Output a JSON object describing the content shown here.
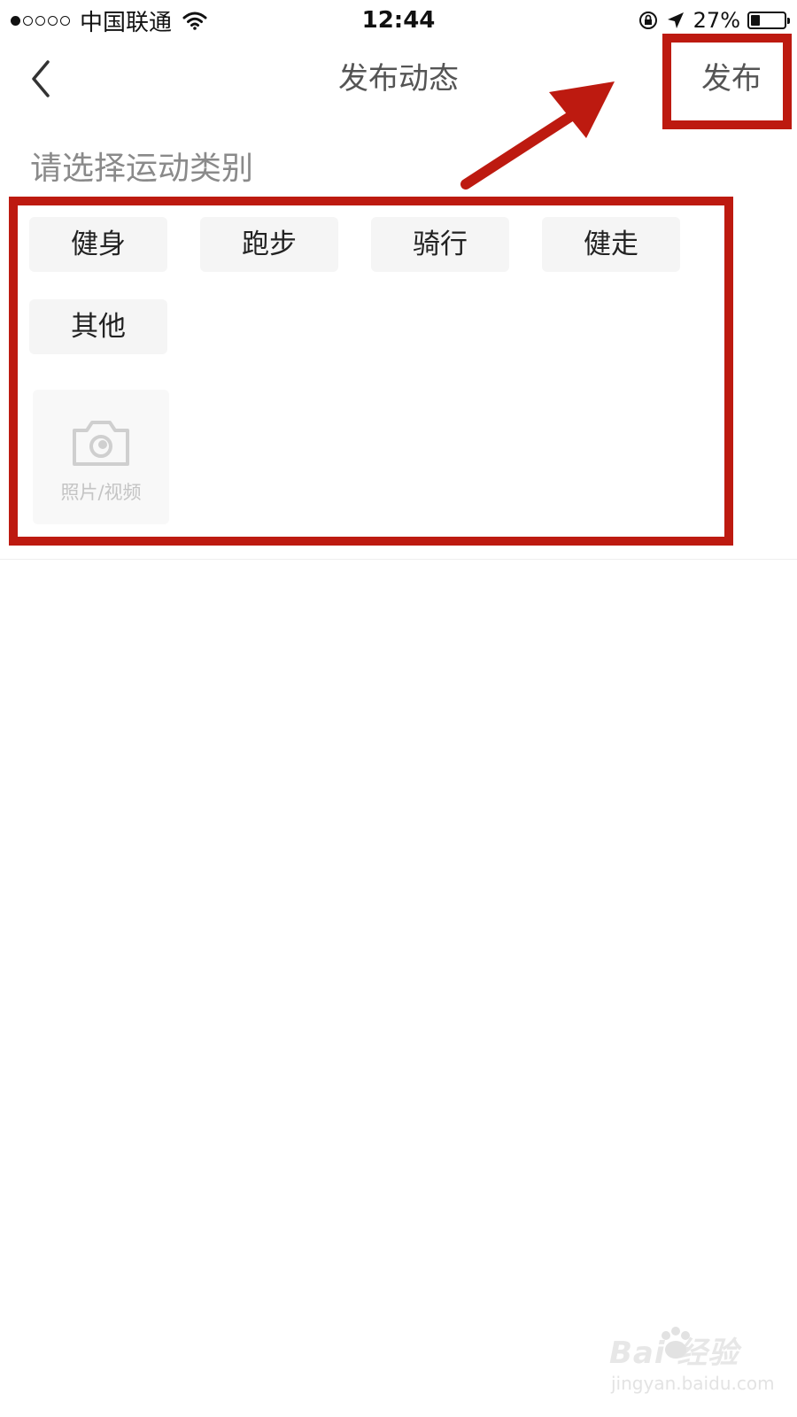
{
  "status_bar": {
    "carrier": "中国联通",
    "time": "12:44",
    "battery_percent": "27%",
    "battery_level": 0.27,
    "signal_dots_filled": 1,
    "signal_dots_total": 5,
    "icons": [
      "signal-dots-icon",
      "wifi-icon",
      "rotation-lock-icon",
      "location-arrow-icon",
      "battery-icon"
    ]
  },
  "nav": {
    "back_icon": "chevron-left-icon",
    "title": "发布动态",
    "publish_label": "发布"
  },
  "content": {
    "section_label": "请选择运动类别",
    "categories": [
      "健身",
      "跑步",
      "骑行",
      "健走",
      "其他"
    ],
    "media_picker": {
      "icon": "camera-icon",
      "label": "照片/视频"
    }
  },
  "annotations": {
    "color": "#bd1a10",
    "items": [
      "highlight-box-publish",
      "highlight-box-categories",
      "arrow-to-publish"
    ]
  },
  "watermark": {
    "logo": "Bai  经验",
    "url": "jingyan.baidu.com"
  },
  "colors": {
    "title_text": "#555555",
    "label_text": "#8a8a8a",
    "chip_bg": "#f5f5f5",
    "annotation_red": "#bd1a10"
  }
}
